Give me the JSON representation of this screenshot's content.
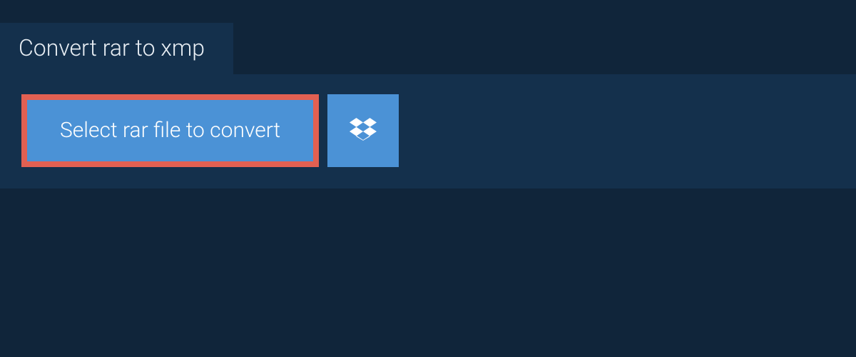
{
  "header": {
    "title": "Convert rar to xmp"
  },
  "main": {
    "select_button_label": "Select rar file to convert"
  },
  "icons": {
    "dropbox": "dropbox-icon"
  },
  "colors": {
    "page_bg": "#10253a",
    "panel_bg": "#14304c",
    "button_bg": "#4b92d6",
    "highlight_border": "#e26052",
    "text_light": "#ffffff"
  }
}
